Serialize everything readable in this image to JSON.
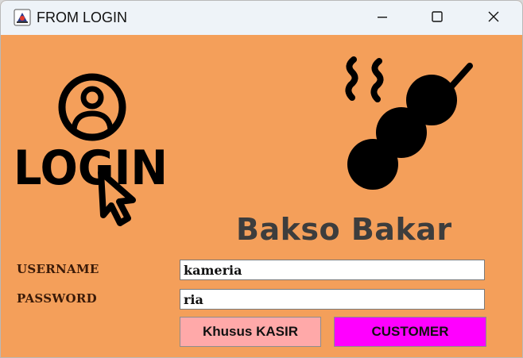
{
  "window": {
    "title": "FROM LOGIN",
    "background_color": "#f49f5a",
    "icon": "java-app-icon",
    "controls": {
      "minimize_icon": "minimize-icon",
      "maximize_icon": "maximize-icon",
      "close_icon": "close-icon"
    }
  },
  "login_art": {
    "text": "LOGIN",
    "icons": [
      "user-circle-icon",
      "hand-cursor-icon"
    ]
  },
  "brand": {
    "title": "Bakso Bakar",
    "icon": "bakso-skewer-icon"
  },
  "form": {
    "username_label": "USERNAME",
    "username_value": "kameria",
    "password_label": "PASSWORD",
    "password_value": "ria"
  },
  "buttons": {
    "kasir_label": "Khusus KASIR",
    "kasir_color": "#ffa9a9",
    "customer_label": "CUSTOMER",
    "customer_color": "#ff00ff"
  }
}
